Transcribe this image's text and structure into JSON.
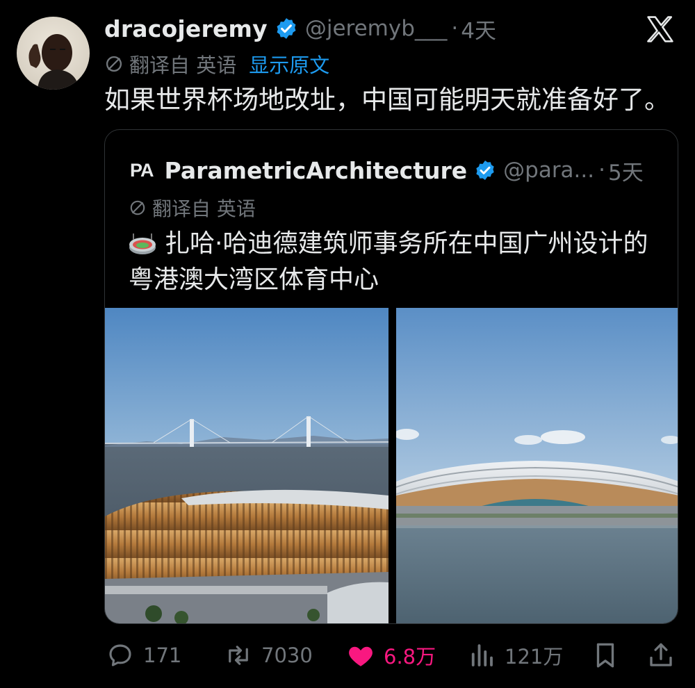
{
  "tweet": {
    "author_name": "dracojeremy",
    "handle": "@jeremyb___",
    "separator": "·",
    "time": "4天",
    "translated_from": "翻译自 英语",
    "show_original": "显示原文",
    "text": "如果世界杯场地改址，中国可能明天就准备好了。"
  },
  "quote": {
    "logo_text": "PA",
    "author_name": "ParametricArchitecture",
    "handle": "@para...",
    "separator": "·",
    "time": "5天",
    "translated_from": "翻译自 英语",
    "text_line1": "扎哈·哈迪德建筑师事务所在中国广州设计的",
    "text_line2": "粤港澳大湾区体育中心"
  },
  "actions": {
    "replies": "171",
    "reposts": "7030",
    "likes": "6.8万",
    "views": "121万"
  },
  "colors": {
    "background": "#000000",
    "text": "#e7e9ea",
    "secondary": "#71767b",
    "link": "#1d9bf0",
    "like": "#f91880",
    "verified": "#1d9bf0"
  },
  "icons": [
    "verified-badge-icon",
    "x-logo-icon",
    "translate-icon",
    "stadium-emoji-icon",
    "reply-icon",
    "repost-icon",
    "like-icon",
    "views-icon",
    "bookmark-icon",
    "share-icon"
  ]
}
